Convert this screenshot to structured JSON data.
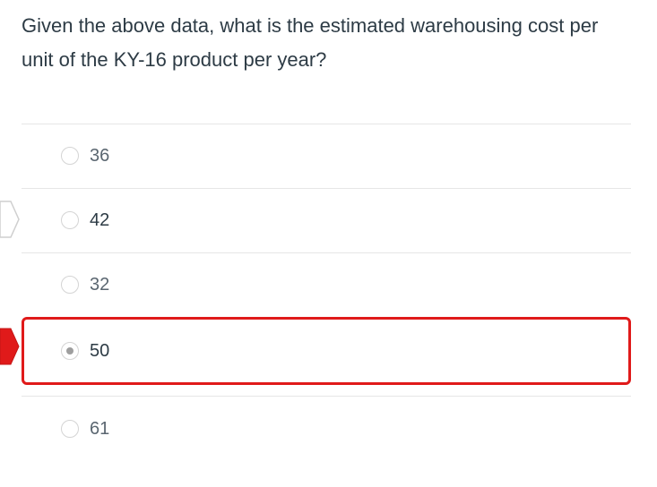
{
  "question": {
    "text": "Given the above data, what is the estimated warehousing cost per unit of the KY-16 product per year?"
  },
  "answers": [
    {
      "label": "36",
      "checked": false
    },
    {
      "label": "42",
      "checked": false
    },
    {
      "label": "32",
      "checked": false
    },
    {
      "label": "50",
      "checked": true
    },
    {
      "label": "61",
      "checked": false
    }
  ],
  "indicators": {
    "correct_answer_marker": "white-arrow-icon",
    "selected_answer_marker": "red-arrow-icon",
    "selected_color": "#e01a1a"
  }
}
